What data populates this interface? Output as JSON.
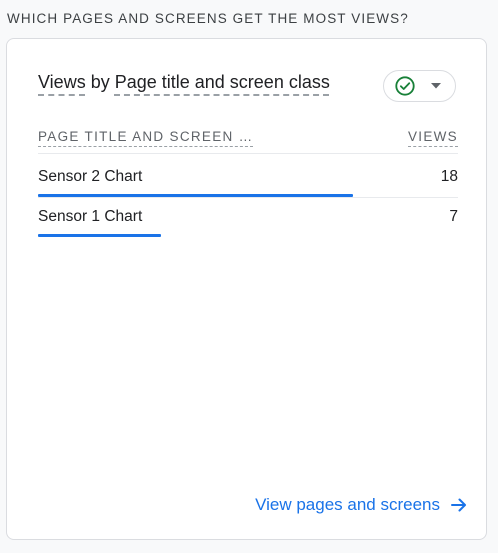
{
  "section": {
    "heading": "WHICH PAGES AND SCREENS GET THE MOST VIEWS?"
  },
  "card": {
    "title_prefix": "Views",
    "title_by": " by ",
    "title_dimension": "Page title and screen class",
    "status_icon": "check-circle-icon",
    "dropdown_icon": "caret-down-icon",
    "accent_color": "#1a73e8",
    "status_color": "#188038",
    "table": {
      "columns": [
        "PAGE TITLE AND SCREEN …",
        "VIEWS"
      ],
      "max_views": 24,
      "rows": [
        {
          "label": "Sensor 2 Chart",
          "views": 18
        },
        {
          "label": "Sensor 1 Chart",
          "views": 7
        }
      ]
    },
    "footer_link": "View pages and screens",
    "footer_icon": "arrow-right-icon"
  }
}
